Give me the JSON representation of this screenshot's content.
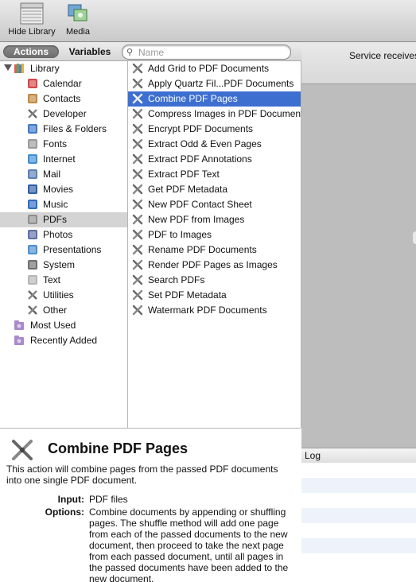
{
  "toolbar": {
    "hide_library_label": "Hide Library",
    "media_label": "Media"
  },
  "library_tabs": {
    "actions_label": "Actions",
    "variables_label": "Variables",
    "search_placeholder": "Name"
  },
  "library": {
    "root_label": "Library",
    "items": [
      {
        "label": "Calendar",
        "icon": "calendar-icon"
      },
      {
        "label": "Contacts",
        "icon": "contacts-icon"
      },
      {
        "label": "Developer",
        "icon": "developer-icon"
      },
      {
        "label": "Files & Folders",
        "icon": "finder-icon"
      },
      {
        "label": "Fonts",
        "icon": "fonts-icon"
      },
      {
        "label": "Internet",
        "icon": "internet-icon"
      },
      {
        "label": "Mail",
        "icon": "mail-icon"
      },
      {
        "label": "Movies",
        "icon": "movies-icon"
      },
      {
        "label": "Music",
        "icon": "music-icon"
      },
      {
        "label": "PDFs",
        "icon": "pdf-icon",
        "selected": true
      },
      {
        "label": "Photos",
        "icon": "photos-icon"
      },
      {
        "label": "Presentations",
        "icon": "presentations-icon"
      },
      {
        "label": "System",
        "icon": "system-icon"
      },
      {
        "label": "Text",
        "icon": "text-icon"
      },
      {
        "label": "Utilities",
        "icon": "utilities-icon"
      },
      {
        "label": "Other",
        "icon": "other-icon"
      }
    ],
    "smart_groups": [
      {
        "label": "Most Used",
        "icon": "smart-folder-icon"
      },
      {
        "label": "Recently Added",
        "icon": "smart-folder-icon"
      }
    ]
  },
  "actions": {
    "items": [
      "Add Grid to PDF Documents",
      "Apply Quartz Fil...PDF Documents",
      "Combine PDF Pages",
      "Compress Images in PDF Documents",
      "Encrypt PDF Documents",
      "Extract Odd & Even Pages",
      "Extract PDF Annotations",
      "Extract PDF Text",
      "Get PDF Metadata",
      "New PDF Contact Sheet",
      "New PDF from Images",
      "PDF to Images",
      "Rename PDF Documents",
      "Render PDF Pages as Images",
      "Search PDFs",
      "Set PDF Metadata",
      "Watermark PDF Documents"
    ],
    "selected_index": 2
  },
  "workflow": {
    "service_text": "Service receives"
  },
  "log": {
    "header": "Log"
  },
  "description": {
    "title": "Combine PDF Pages",
    "summary": "This action will combine pages from the passed PDF documents into one single PDF document.",
    "input_key": "Input:",
    "input_val": "PDF files",
    "options_key": "Options:",
    "options_val": "Combine documents by appending or shuffling pages. The shuffle method will add one page from each of the passed documents to the new document, then proceed to take the next page from each passed document, until all pages in the passed documents have been added to the new document."
  },
  "colors": {
    "selection_blue": "#3d6fd1",
    "library_selection_gray": "#d4d4d4",
    "workflow_gray": "#bdbdbd"
  }
}
